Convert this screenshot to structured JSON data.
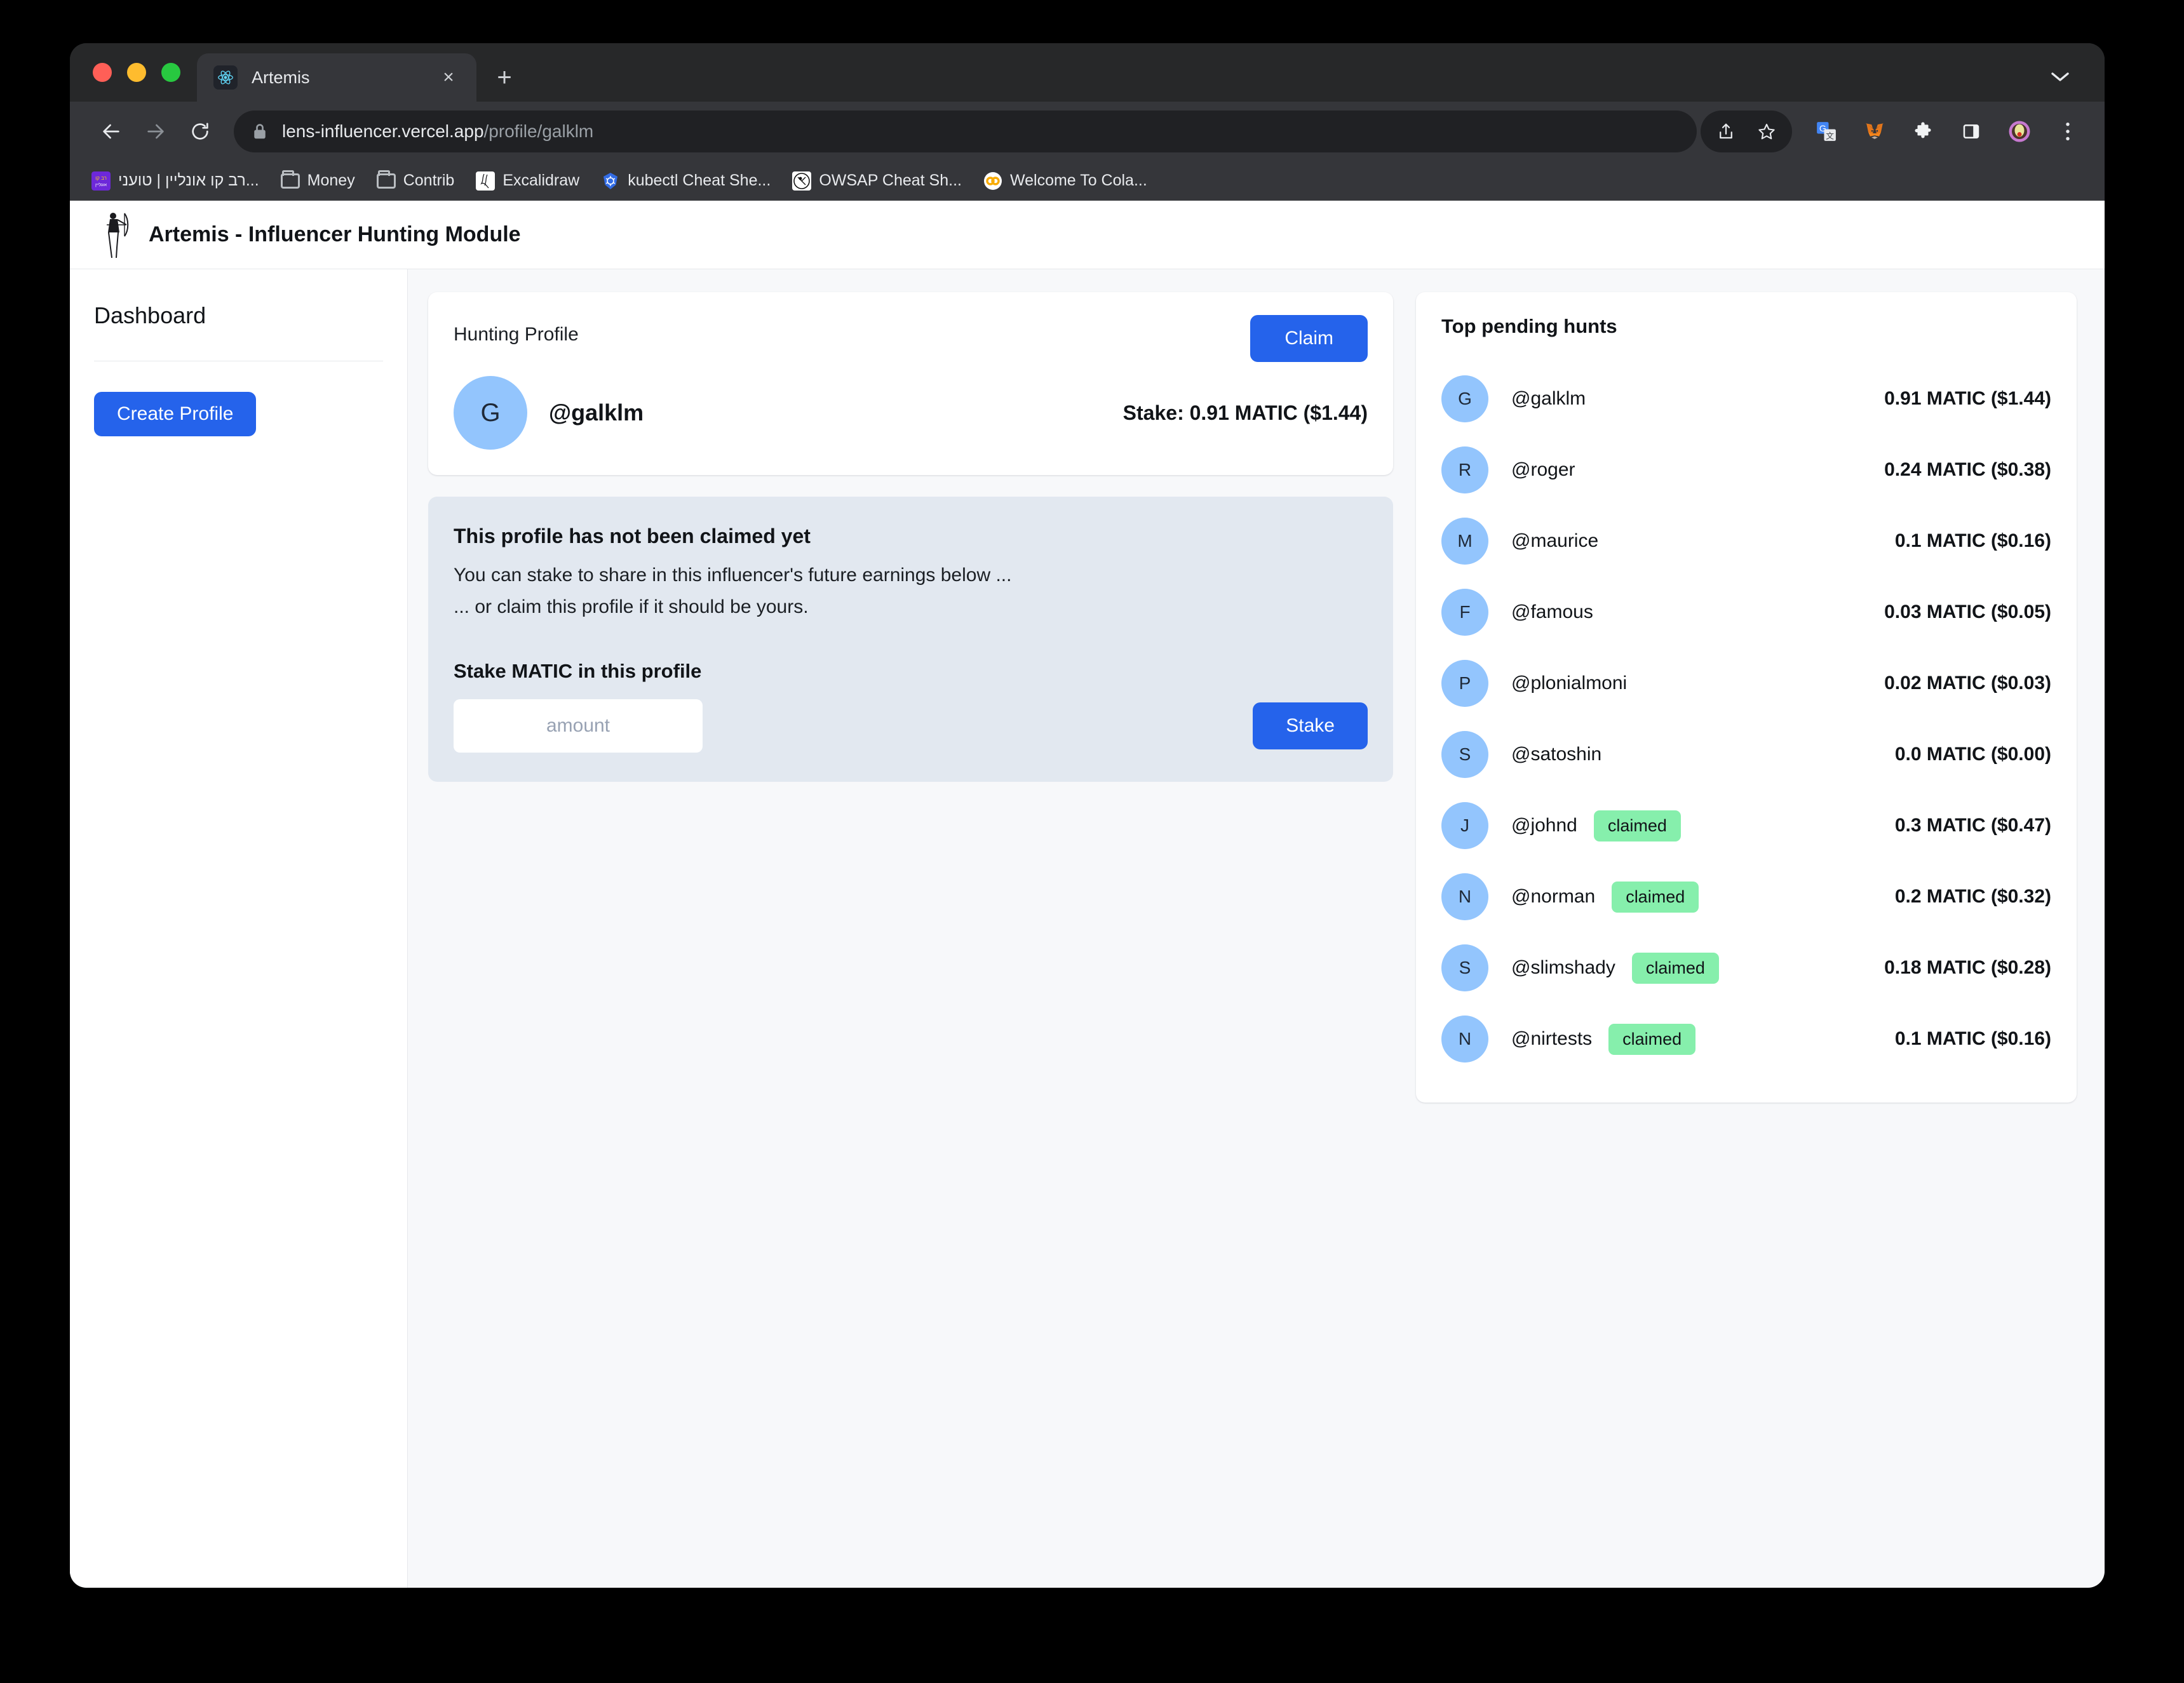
{
  "browser": {
    "tab": {
      "title": "Artemis",
      "favicon": "react-icon",
      "close_label": "×"
    },
    "new_tab_label": "+",
    "tab_list_icon": "chevron-down-icon",
    "omnibox": {
      "lock_icon": "lock-icon",
      "url_domain": "lens-influencer.vercel.app",
      "url_path": "/profile/galklm",
      "share_icon": "share-icon",
      "bookmark_icon": "star-icon"
    },
    "toolbar_icons": [
      "back-arrow-icon",
      "forward-arrow-icon",
      "reload-icon",
      "google-translate-icon",
      "metamask-fox-icon",
      "extensions-puzzle-icon",
      "side-panel-icon",
      "profile-avatar-icon",
      "chrome-menu-icon"
    ],
    "bookmarks": [
      {
        "label": "רב קו אונליין | טועני...",
        "icon": "ravkav-icon"
      },
      {
        "label": "Money",
        "icon": "folder-icon"
      },
      {
        "label": "Contrib",
        "icon": "folder-icon"
      },
      {
        "label": "Excalidraw",
        "icon": "excalidraw-icon"
      },
      {
        "label": "kubectl Cheat She...",
        "icon": "kubernetes-icon"
      },
      {
        "label": "OWSAP Cheat Sh...",
        "icon": "owasp-icon"
      },
      {
        "label": "Welcome To Cola...",
        "icon": "colab-icon"
      }
    ]
  },
  "app": {
    "header": {
      "title": "Artemis - Influencer Hunting Module",
      "logo": "archer-artemis-icon"
    },
    "sidebar": {
      "title": "Dashboard",
      "create_profile_label": "Create Profile"
    },
    "profile_card": {
      "label": "Hunting Profile",
      "claim_label": "Claim",
      "avatar_initial": "G",
      "handle": "@galklm",
      "stake": "Stake: 0.91 MATIC ($1.44)"
    },
    "stake_panel": {
      "heading": "This profile has not been claimed yet",
      "line1": "You can stake to share in this influencer's future earnings below ...",
      "line2": "... or claim this profile if it should be yours.",
      "form_label": "Stake MATIC in this profile",
      "amount_value": "",
      "amount_placeholder": "amount",
      "stake_button_label": "Stake"
    },
    "pending_hunts": {
      "title": "Top pending hunts",
      "rows": [
        {
          "initial": "G",
          "handle": "@galklm",
          "badge": "",
          "amount": "0.91 MATIC ($1.44)"
        },
        {
          "initial": "R",
          "handle": "@roger",
          "badge": "",
          "amount": "0.24 MATIC ($0.38)"
        },
        {
          "initial": "M",
          "handle": "@maurice",
          "badge": "",
          "amount": "0.1 MATIC ($0.16)"
        },
        {
          "initial": "F",
          "handle": "@famous",
          "badge": "",
          "amount": "0.03 MATIC ($0.05)"
        },
        {
          "initial": "P",
          "handle": "@plonialmoni",
          "badge": "",
          "amount": "0.02 MATIC ($0.03)"
        },
        {
          "initial": "S",
          "handle": "@satoshin",
          "badge": "",
          "amount": "0.0 MATIC ($0.00)"
        },
        {
          "initial": "J",
          "handle": "@johnd",
          "badge": "claimed",
          "amount": "0.3 MATIC ($0.47)"
        },
        {
          "initial": "N",
          "handle": "@norman",
          "badge": "claimed",
          "amount": "0.2 MATIC ($0.32)"
        },
        {
          "initial": "S",
          "handle": "@slimshady",
          "badge": "claimed",
          "amount": "0.18 MATIC ($0.28)"
        },
        {
          "initial": "N",
          "handle": "@nirtests",
          "badge": "claimed",
          "amount": "0.1 MATIC ($0.16)"
        }
      ]
    }
  },
  "colors": {
    "accent_blue": "#2563eb",
    "avatar_blue": "#93c5fd",
    "badge_green": "#86efac",
    "panel_gray": "#e2e8f0",
    "page_bg": "#f7f8fa",
    "chrome_dark": "#35363a"
  }
}
